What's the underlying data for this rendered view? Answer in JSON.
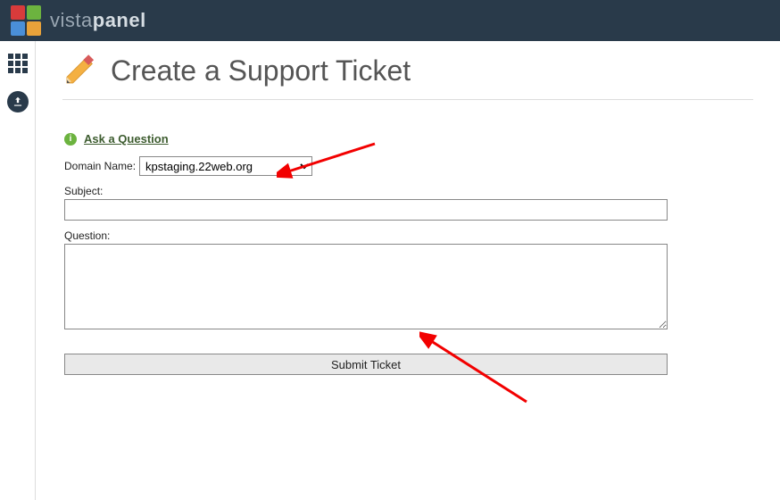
{
  "brand": {
    "part1": "vista",
    "part2": "panel"
  },
  "page": {
    "title": "Create a Support Ticket"
  },
  "form": {
    "ask_link": "Ask a Question",
    "domain_label": "Domain Name:",
    "domain_selected": "kpstaging.22web.org",
    "subject_label": "Subject:",
    "subject_value": "",
    "question_label": "Question:",
    "question_value": "",
    "submit_label": "Submit Ticket"
  },
  "icons": {
    "apps": "apps-grid-icon",
    "upload": "upload-icon",
    "pencil": "pencil-icon",
    "info": "info-icon"
  }
}
